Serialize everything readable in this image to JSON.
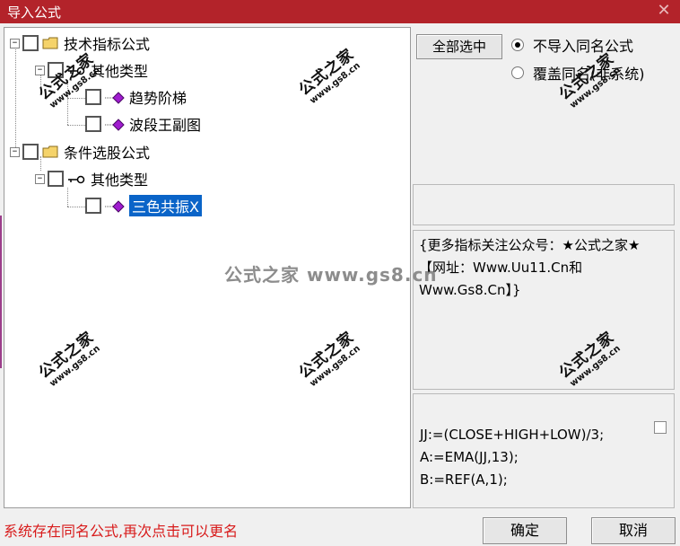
{
  "window": {
    "title": "导入公式",
    "close_glyph": "✕"
  },
  "tree": {
    "nodes": [
      {
        "label": "技术指标公式",
        "kind": "folder",
        "expander": "−"
      },
      {
        "label": "其他类型",
        "kind": "key",
        "expander": "−"
      },
      {
        "label": "趋势阶梯",
        "kind": "formula"
      },
      {
        "label": "波段王副图",
        "kind": "formula"
      },
      {
        "label": "条件选股公式",
        "kind": "folder",
        "expander": "−"
      },
      {
        "label": "其他类型",
        "kind": "key",
        "expander": "−"
      },
      {
        "label": "三色共振X",
        "kind": "formula",
        "selected": true
      }
    ]
  },
  "options": {
    "select_all_label": "全部选中",
    "radio_no_import": "不导入同名公式",
    "radio_overwrite": "覆盖同名(非系统)",
    "selected": "no_import"
  },
  "description": {
    "text": "{更多指标关注公众号：★公式之家★ 【网址：Www.Uu11.Cn和Www.Gs8.Cn】}"
  },
  "code": {
    "lines": [
      "JJ:=(CLOSE+HIGH+LOW)/3;",
      "A:=EMA(JJ,13);",
      "B:=REF(A,1);"
    ]
  },
  "status_text": "系统存在同名公式,再次点击可以更名",
  "buttons": {
    "ok": "确定",
    "cancel": "取消"
  },
  "watermark": {
    "main": "公式之家",
    "sub": "www.gs8.cn",
    "center": "公式之家 www.gs8.cn"
  },
  "colors": {
    "titlebar": "#b3232a",
    "selection": "#0a64c8",
    "status_text": "#d81b1b",
    "gem": "#a01ccf"
  }
}
